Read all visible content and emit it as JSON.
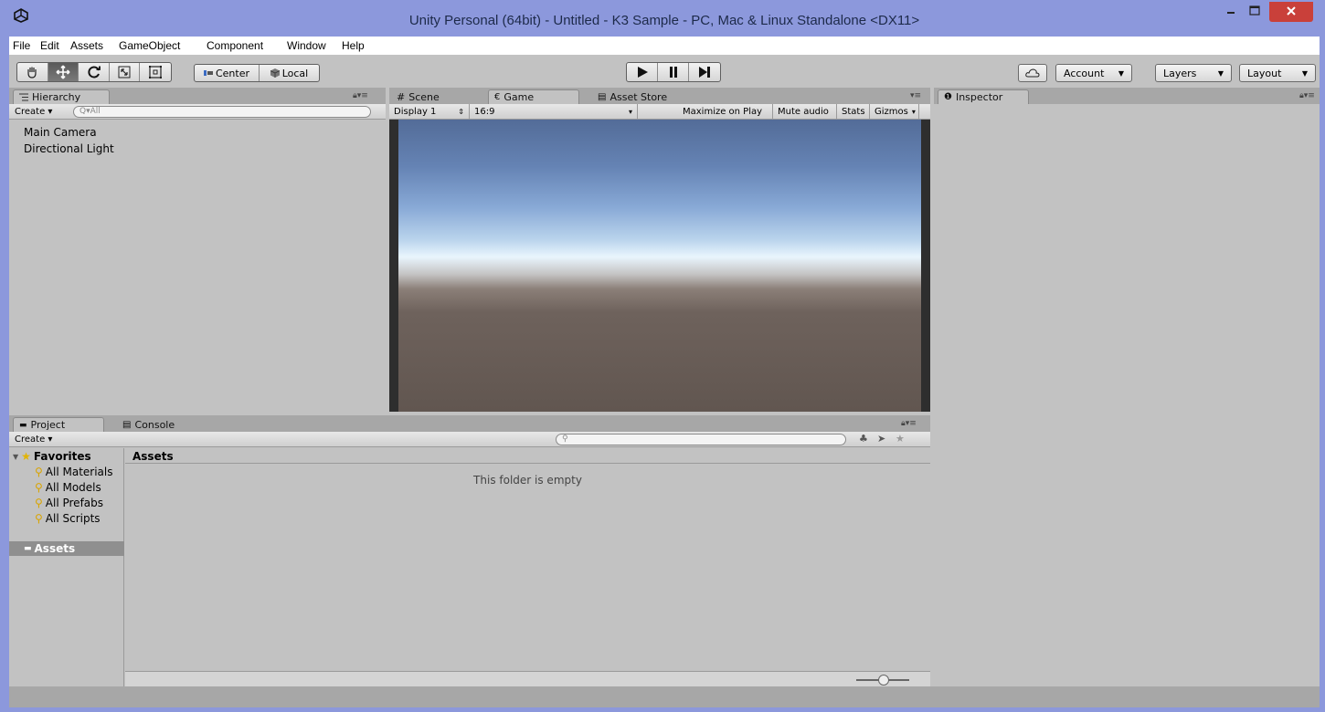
{
  "window": {
    "title": "Unity Personal (64bit) - Untitled - K3 Sample - PC, Mac & Linux Standalone <DX11>",
    "controls": [
      "minimize-icon",
      "maximize-icon",
      "close-icon"
    ]
  },
  "menu": [
    "File",
    "Edit",
    "Assets",
    "GameObject",
    "Component",
    "Window",
    "Help"
  ],
  "toolbar": {
    "tools": [
      "hand-icon",
      "move-icon",
      "rotate-icon",
      "scale-icon",
      "rect-icon"
    ],
    "pivot": {
      "center": "Center",
      "local": "Local"
    },
    "play": [
      "play-icon",
      "pause-icon",
      "step-icon"
    ],
    "account": "Account",
    "layers": "Layers",
    "layout": "Layout"
  },
  "hierarchy": {
    "tab": "Hierarchy",
    "create": "Create",
    "search_placeholder": "Q▾All",
    "items": [
      "Main Camera",
      "Directional Light"
    ]
  },
  "center_tabs": [
    "Scene",
    "Game",
    "Asset Store"
  ],
  "game": {
    "display": "Display 1",
    "aspect": "16:9",
    "maximize": "Maximize on Play",
    "mute": "Mute audio",
    "stats": "Stats",
    "gizmos": "Gizmos"
  },
  "inspector": {
    "tab": "Inspector"
  },
  "project": {
    "tabs": [
      "Project",
      "Console"
    ],
    "create": "Create",
    "favorites_label": "Favorites",
    "favorites": [
      "All Materials",
      "All Models",
      "All Prefabs",
      "All Scripts"
    ],
    "assets_folder": "Assets",
    "breadcrumb": "Assets",
    "empty_message": "This folder is empty"
  },
  "colors": {
    "titlebar": "#8c98dc",
    "editor_bg": "#c2c2c2",
    "close_button": "#c9403a",
    "selected_row": "#8f8f8f"
  }
}
